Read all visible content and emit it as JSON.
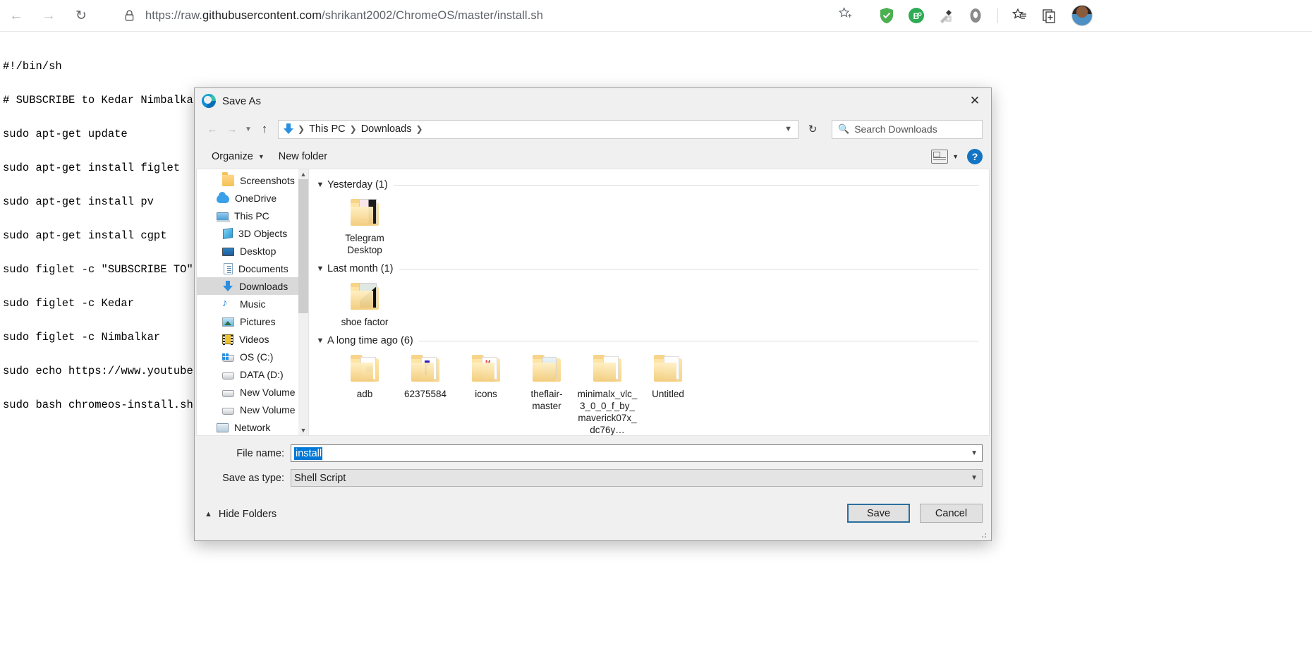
{
  "browser": {
    "back_icon": "arrow-left-icon",
    "forward_icon": "arrow-right-icon",
    "reload_icon": "reload-icon",
    "lock_icon": "lock-icon",
    "url_prefix": "https://raw.",
    "url_domain": "githubusercontent.com",
    "url_path": "/shrikant2002/ChromeOS/master/install.sh",
    "url_full": "https://raw.githubusercontent.com/shrikant2002/ChromeOS/master/install.sh",
    "star_icon": "favorite-star-icon",
    "extensions": [
      {
        "name": "adguard-shield-icon",
        "color": "#4caf50"
      },
      {
        "name": "bitwarden-icon",
        "color": "#2eab54"
      },
      {
        "name": "color-picker-icon",
        "color": "#555555"
      },
      {
        "name": "grammarly-icon",
        "color": "#7a7a7a"
      }
    ],
    "collections_icon": "collections-icon",
    "favorites_icon": "favorites-list-icon",
    "profile_icon": "profile-avatar"
  },
  "page": {
    "lines": [
      "#!/bin/sh",
      "# SUBSCRIBE to Kedar Nimbalkar on youtube for more such videos https://www.youtube.com/user/kedar123456889",
      "sudo apt-get update",
      "sudo apt-get install figlet",
      "sudo apt-get install pv",
      "sudo apt-get install cgpt",
      "sudo figlet -c \"SUBSCRIBE TO\"",
      "sudo figlet -c Kedar",
      "sudo figlet -c Nimbalkar",
      "sudo echo https://www.youtube.com/us",
      "sudo bash chromeos-install.sh -src "
    ]
  },
  "dialog": {
    "title": "Save As",
    "app_icon": "edge-logo-icon",
    "close_icon": "close-icon",
    "nav": {
      "back_icon": "back-arrow-icon",
      "forward_icon": "forward-arrow-icon",
      "recent_icon": "recent-locations-chevron-icon",
      "up_icon": "up-arrow-icon",
      "location_icon": "downloads-arrow-icon",
      "breadcrumbs": [
        "This PC",
        "Downloads"
      ],
      "dropdown_icon": "chevron-down-icon",
      "refresh_icon": "refresh-icon"
    },
    "search": {
      "icon": "search-icon",
      "placeholder": "Search Downloads"
    },
    "commandbar": {
      "organize": "Organize",
      "organize_caret": "caret-down-icon",
      "new_folder": "New folder",
      "view_icon": "change-view-icon",
      "view_caret": "caret-down-icon",
      "help_icon": "help-icon",
      "help_glyph": "?"
    },
    "sidebar": {
      "items": [
        {
          "label": "Screenshots",
          "icon": "folder-icon",
          "indent": 1,
          "selected": false
        },
        {
          "label": "OneDrive",
          "icon": "onedrive-cloud-icon",
          "indent": 0,
          "selected": false
        },
        {
          "label": "This PC",
          "icon": "this-pc-icon",
          "indent": 0,
          "selected": false
        },
        {
          "label": "3D Objects",
          "icon": "3d-objects-icon",
          "indent": 1,
          "selected": false
        },
        {
          "label": "Desktop",
          "icon": "desktop-icon",
          "indent": 1,
          "selected": false
        },
        {
          "label": "Documents",
          "icon": "documents-icon",
          "indent": 1,
          "selected": false
        },
        {
          "label": "Downloads",
          "icon": "downloads-icon",
          "indent": 1,
          "selected": true
        },
        {
          "label": "Music",
          "icon": "music-icon",
          "indent": 1,
          "selected": false
        },
        {
          "label": "Pictures",
          "icon": "pictures-icon",
          "indent": 1,
          "selected": false
        },
        {
          "label": "Videos",
          "icon": "videos-icon",
          "indent": 1,
          "selected": false
        },
        {
          "label": "OS (C:)",
          "icon": "os-drive-icon",
          "indent": 1,
          "selected": false
        },
        {
          "label": "DATA (D:)",
          "icon": "drive-icon",
          "indent": 1,
          "selected": false
        },
        {
          "label": "New Volume (E:)",
          "icon": "drive-icon",
          "indent": 1,
          "selected": false
        },
        {
          "label": "New Volume (F:)",
          "icon": "drive-icon",
          "indent": 1,
          "selected": false
        },
        {
          "label": "Network",
          "icon": "network-icon",
          "indent": 0,
          "selected": false
        }
      ],
      "scroll_up_icon": "scroll-up-icon",
      "scroll_down_icon": "scroll-down-icon"
    },
    "filelist": {
      "groups": [
        {
          "label": "Yesterday (1)",
          "chevron": "chevron-down-icon",
          "items": [
            {
              "name": "Telegram Desktop",
              "thumb": "telegram-folder-thumb"
            }
          ]
        },
        {
          "label": "Last month (1)",
          "chevron": "chevron-down-icon",
          "items": [
            {
              "name": "shoe factor",
              "thumb": "shoe-folder-thumb"
            }
          ]
        },
        {
          "label": "A long time ago (6)",
          "chevron": "chevron-down-icon",
          "items": [
            {
              "name": "adb",
              "thumb": "adb-folder-thumb"
            },
            {
              "name": "62375584",
              "thumb": "blue-doc-folder-thumb"
            },
            {
              "name": "icons",
              "thumb": "icons-folder-thumb"
            },
            {
              "name": "theflair-master",
              "thumb": "flair-folder-thumb"
            },
            {
              "name": "minimalx_vlc_3_0_0_f_by_maverick07x_dc76y…",
              "thumb": "plain-folder-thumb"
            },
            {
              "name": "Untitled",
              "thumb": "plain-folder-thumb"
            }
          ]
        }
      ]
    },
    "form": {
      "filename_label": "File name:",
      "filename_value": "install",
      "filename_caret": "caret-down-icon",
      "filetype_label": "Save as type:",
      "filetype_value": "Shell Script",
      "filetype_caret": "caret-down-icon"
    },
    "footer": {
      "hide_folders": "Hide Folders",
      "hide_folders_icon": "chevron-up-icon",
      "save": "Save",
      "cancel": "Cancel"
    },
    "colors": {
      "accent": "#0078d7",
      "default_button_border": "#2a6f9e",
      "selection": "#0078d7"
    }
  }
}
